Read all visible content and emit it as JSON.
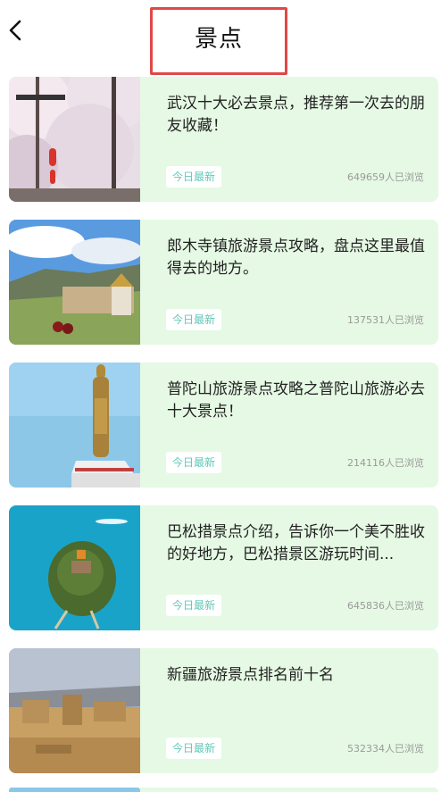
{
  "header": {
    "title": "景点",
    "back_icon": "chevron-left-icon"
  },
  "items": [
    {
      "title": "武汉十大必去景点，推荐第一次去的朋友收藏！",
      "tag": "今日最新",
      "views": "649659人已浏览"
    },
    {
      "title": "郎木寺镇旅游景点攻略，盘点这里最值得去的地方。",
      "tag": "今日最新",
      "views": "137531人已浏览"
    },
    {
      "title": "普陀山旅游景点攻略之普陀山旅游必去十大景点！",
      "tag": "今日最新",
      "views": "214116人已浏览"
    },
    {
      "title": "巴松措景点介绍，告诉你一个美不胜收的好地方，巴松措景区游玩时间...",
      "tag": "今日最新",
      "views": "645836人已浏览"
    },
    {
      "title": "新疆旅游景点排名前十名",
      "tag": "今日最新",
      "views": "532334人已浏览"
    }
  ],
  "colors": {
    "card_bg": "#e5f9e4",
    "tag_text": "#63c8b8",
    "highlight_border": "#e04848"
  }
}
